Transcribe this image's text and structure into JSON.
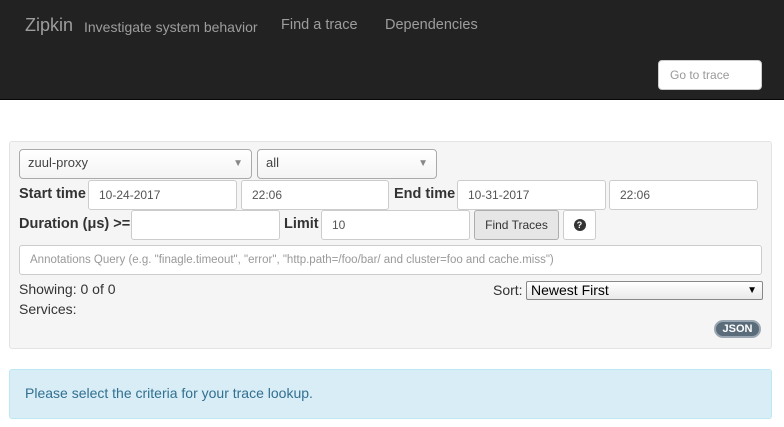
{
  "navbar": {
    "brand": "Zipkin",
    "tagline": "Investigate system behavior",
    "links": [
      "Find a trace",
      "Dependencies"
    ],
    "goto_placeholder": "Go to trace"
  },
  "search": {
    "service_value": "zuul-proxy",
    "span_value": "all",
    "start_label": "Start time",
    "start_date": "10-24-2017",
    "start_time": "22:06",
    "end_label": "End time",
    "end_date": "10-31-2017",
    "end_time": "22:06",
    "duration_label": "Duration (μs) >=",
    "duration_value": "",
    "limit_label": "Limit",
    "limit_value": "10",
    "find_button": "Find Traces",
    "help_icon": "question-circle-icon",
    "annotations_placeholder": "Annotations Query (e.g. \"finagle.timeout\", \"error\", \"http.path=/foo/bar/ and cluster=foo and cache.miss\")"
  },
  "results": {
    "showing": "Showing: 0 of 0",
    "services": "Services:",
    "sort_label": "Sort:",
    "sort_value": "Newest First",
    "json_badge": "JSON"
  },
  "alert": {
    "message": "Please select the criteria for your trace lookup."
  },
  "colors": {
    "navbar_bg": "#222222",
    "alert_bg": "#d9edf7",
    "alert_text": "#31708f"
  }
}
